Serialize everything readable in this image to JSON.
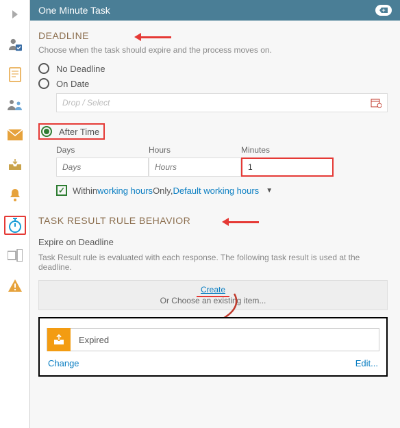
{
  "header": {
    "title": "One Minute Task"
  },
  "deadline": {
    "heading": "DEADLINE",
    "sub": "Choose when the task should expire and the process moves on.",
    "opt_none": "No Deadline",
    "opt_ondate": "On Date",
    "dropsel_placeholder": "Drop / Select",
    "opt_aftertime": "After Time",
    "days_label": "Days",
    "days_placeholder": "Days",
    "hours_label": "Hours",
    "hours_placeholder": "Hours",
    "minutes_label": "Minutes",
    "minutes_value": "1",
    "within_pre": "Within ",
    "working_hours": "working hours",
    "within_mid": " Only, ",
    "default_wh": "Default working hours"
  },
  "rule": {
    "heading": "TASK RESULT RULE BEHAVIOR",
    "expire_title": "Expire on Deadline",
    "expire_desc": "Task Result rule is evaluated with each response. The following task result is used at the deadline.",
    "create": "Create",
    "or_choose": "Or Choose an existing item...",
    "expired_label": "Expired",
    "change": "Change",
    "edit": "Edit..."
  }
}
